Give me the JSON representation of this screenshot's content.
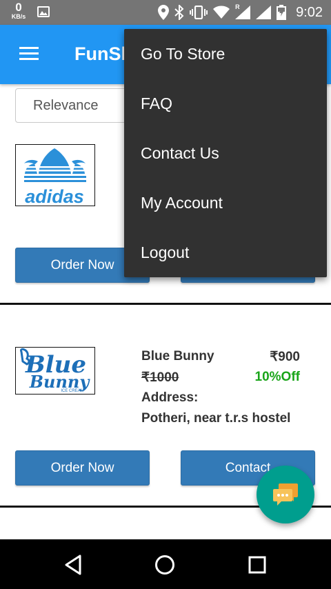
{
  "status_bar": {
    "speed_value": "0",
    "speed_unit": "KB/s",
    "time": "9:02",
    "roaming_label": "R",
    "icons": [
      "image-icon",
      "location-icon",
      "bluetooth-icon",
      "vibrate-icon",
      "wifi-icon",
      "signal-icon",
      "battery-icon"
    ]
  },
  "app_bar": {
    "title": "FunSh",
    "color": "#2196f3"
  },
  "sort": {
    "selected": "Relevance"
  },
  "stores": [
    {
      "logo": "adidas",
      "order_label": "Order Now",
      "contact_label": "Contact"
    },
    {
      "logo": "Blue Bunny",
      "logo_sub": "ICE CREAM",
      "name": "Blue Bunny",
      "price": "₹900",
      "original_price": "₹1000",
      "discount": "10%Off",
      "address_label": "Address:",
      "address": "Potheri, near t.r.s hostel",
      "order_label": "Order Now",
      "contact_label": "Contact"
    }
  ],
  "menu": {
    "items": [
      "Go To Store",
      "FAQ",
      "Contact Us",
      "My Account",
      "Logout"
    ]
  },
  "fab": {
    "icon": "chat-icon",
    "color": "#009e8e"
  },
  "nav_bar": {
    "icons": [
      "back-icon",
      "home-icon",
      "recents-icon"
    ]
  }
}
